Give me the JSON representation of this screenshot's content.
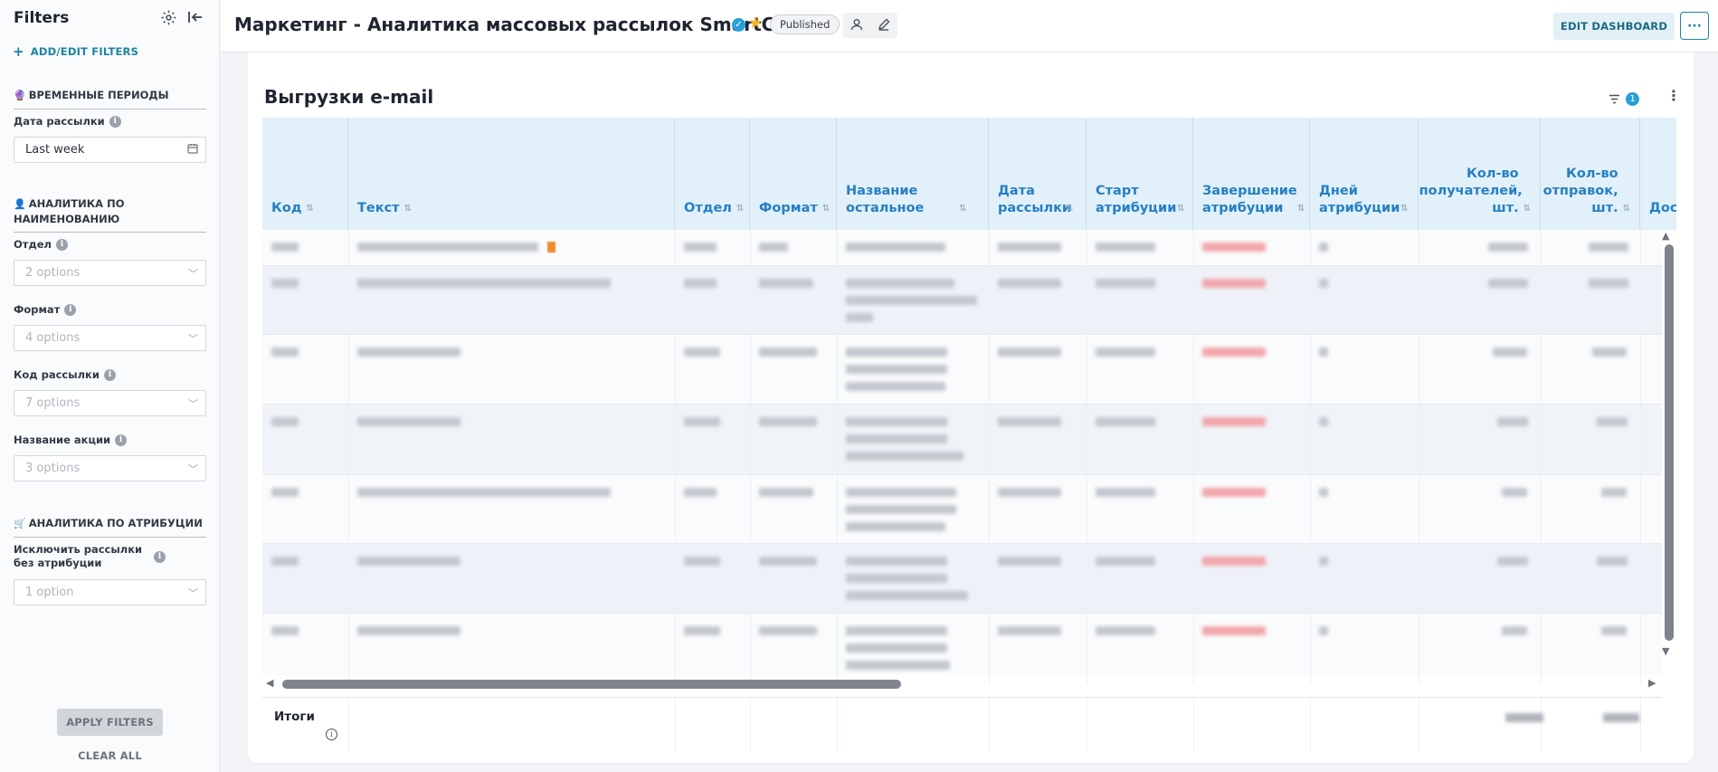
{
  "sidebar": {
    "title": "Filters",
    "add_filters": "ADD/EDIT FILTERS",
    "sections": [
      {
        "emoji": "🔮",
        "label": "ВРЕМЕННЫЕ ПЕРИОДЫ"
      },
      {
        "emoji": "👤",
        "label": "АНАЛИТИКА ПО НАИМЕНОВАНИЮ"
      },
      {
        "emoji": "🛒",
        "label": "АНАЛИТИКА ПО АТРИБУЦИИ"
      }
    ],
    "filters": [
      {
        "label": "Дата рассылки",
        "value": "Last week"
      },
      {
        "label": "Отдел",
        "value": "2 options"
      },
      {
        "label": "Формат",
        "value": "4 options"
      },
      {
        "label": "Код рассылки",
        "value": "7 options"
      },
      {
        "label": "Название акции",
        "value": "3 options"
      },
      {
        "label": "Исключить рассылки без атрибуции",
        "value": "1 option"
      }
    ],
    "apply": "APPLY FILTERS",
    "clear": "CLEAR ALL"
  },
  "header": {
    "title": "Маркетинг - Аналитика массовых рассылок SmartCom",
    "status": "Published",
    "edit_dashboard": "EDIT DASHBOARD",
    "more": "···"
  },
  "card": {
    "title": "Выгрузки e-mail",
    "filter_count": "1",
    "columns": [
      {
        "label": "Код"
      },
      {
        "label": "Текст"
      },
      {
        "label": "Отдел"
      },
      {
        "label": "Формат"
      },
      {
        "label": "Название остальное"
      },
      {
        "label": "Дата рассылки"
      },
      {
        "label": "Старт атрибуции"
      },
      {
        "label": "Завершение атрибуции"
      },
      {
        "label": "Дней атрибуции"
      },
      {
        "label": "Кол-во получателей, шт."
      },
      {
        "label": "Кол-во отправок, шт."
      },
      {
        "label": "Дост"
      }
    ],
    "totals_label": "Итоги"
  },
  "colors": {
    "accent": "#1a85a0",
    "header_bg": "#e2f0fa",
    "header_text": "#2580c3",
    "star": "#f2b71b"
  }
}
